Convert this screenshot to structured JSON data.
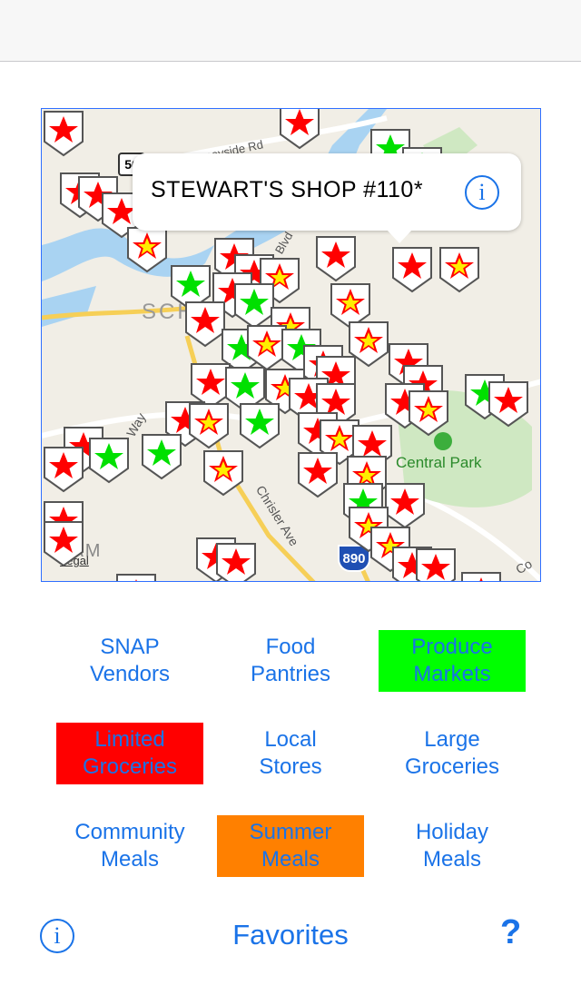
{
  "callout": {
    "title": "STEWART'S SHOP #110*",
    "info_icon": "info-icon"
  },
  "map": {
    "labels": {
      "road_stoneyside": "Stoneyside Rd",
      "route_50": "50",
      "blvd": "Blvd",
      "sch": "SCH",
      "central_park": "Central Park",
      "way": "Way",
      "chrisler": "Chrisler Ave",
      "i890": "890",
      "dam": "DAM",
      "legal": "Legal",
      "cor": "Co"
    },
    "colors": {
      "marker_red": "#ff0000",
      "marker_yellow": "#ffee00",
      "marker_green": "#00e000"
    }
  },
  "categories": [
    {
      "label": "SNAP\nVendors",
      "bg": ""
    },
    {
      "label": "Food\nPantries",
      "bg": ""
    },
    {
      "label": "Produce\nMarkets",
      "bg": "#00ff00"
    },
    {
      "label": "Limited\nGroceries",
      "bg": "#ff0000"
    },
    {
      "label": "Local\nStores",
      "bg": ""
    },
    {
      "label": "Large\nGroceries",
      "bg": ""
    },
    {
      "label": "Community\nMeals",
      "bg": ""
    },
    {
      "label": "Summer\nMeals",
      "bg": "#ff8000"
    },
    {
      "label": "Holiday\nMeals",
      "bg": ""
    }
  ],
  "bottom": {
    "info_icon": "info-icon",
    "favorites": "Favorites",
    "help": "?"
  }
}
